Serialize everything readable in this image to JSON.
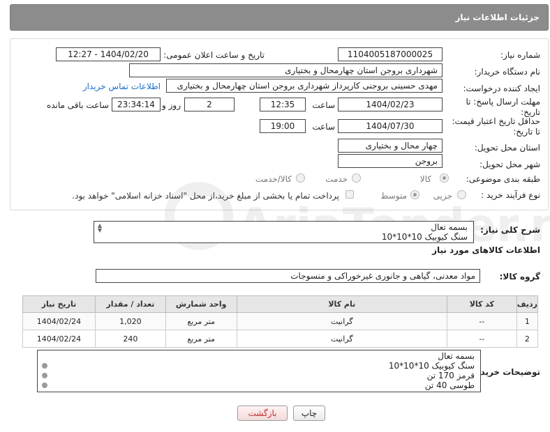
{
  "header": {
    "title": "جزئیات اطلاعات نیاز"
  },
  "fields": {
    "need_number_label": "شماره نیاز:",
    "need_number": "1104005187000025",
    "announce_label": "تاریخ و ساعت اعلان عمومی:",
    "announce_value": "1404/02/20 - 12:27",
    "buyer_org_label": "نام دستگاه خریدار:",
    "buyer_org": "شهرداری بروجن استان چهارمحال و بختیاری",
    "creator_label": "ایجاد کننده درخواست:",
    "creator": "مهدی حسینی بروجنی کارپرداز شهرداری بروجن استان چهارمحال و بختیاری",
    "contact_link": "اطلاعات تماس خریدار",
    "send_deadline_label": "مهلت ارسال پاسخ: تا تاریخ:",
    "send_date": "1404/02/23",
    "time_label": "ساعت",
    "send_time": "12:35",
    "days_value": "2",
    "days_label": "روز و",
    "remaining_time": "23:34:14",
    "remaining_label": "ساعت باقی مانده",
    "price_deadline_label": "حداقل تاریخ اعتبار قیمت: تا تاریخ:",
    "price_date": "1404/07/30",
    "price_time": "19:00",
    "province_label": "استان محل تحویل:",
    "province": "چهار محال و بختیاری",
    "city_label": "شهر محل تحویل:",
    "city": "بروجن",
    "category_label": "طبقه بندی موضوعی:",
    "category_options": [
      "کالا",
      "خدمت",
      "کالا/خدمت"
    ],
    "process_label": "نوع فرآیند خرید :",
    "process_options": [
      "جزیی",
      "متوسط"
    ],
    "payment_note": "پرداخت تمام یا بخشی از مبلغ خرید،از محل \"اسناد خزانه اسلامی\" خواهد بود."
  },
  "description": {
    "label": "شرح کلی نیاز:",
    "lines": [
      "بسمه تعال",
      "سنگ کیوبیک 10*10*10"
    ]
  },
  "goods_section": {
    "title": "اطلاعات کالاهای مورد نیاز"
  },
  "goods_group": {
    "label": "گروه کالا:",
    "value": "مواد معدنی، گیاهی و جانوری غیرخوراکی و منسوجات"
  },
  "table": {
    "headers": [
      "ردیف",
      "کد کالا",
      "نام کالا",
      "واحد شمارش",
      "تعداد / مقدار",
      "تاریخ نیاز"
    ],
    "rows": [
      [
        "1",
        "--",
        "گرانیت",
        "متر مربع",
        "1,020",
        "1404/02/24"
      ],
      [
        "2",
        "--",
        "گرانیت",
        "متر مربع",
        "240",
        "1404/02/24"
      ]
    ]
  },
  "buyer_notes": {
    "label": "توضیحات خریدار:",
    "lines": [
      "بسمه تعال",
      "سنگ کیوبیک 10*10*10",
      "قرمز 170 تن",
      "طوسی 40 تن"
    ]
  },
  "buttons": {
    "print": "چاپ",
    "back": "بازگشت"
  },
  "watermark": {
    "text": "AriaTender.neT"
  },
  "colors": {
    "title_bar": "#8c8c8c",
    "link": "#1a6fc8",
    "back_button": "#c03030"
  }
}
